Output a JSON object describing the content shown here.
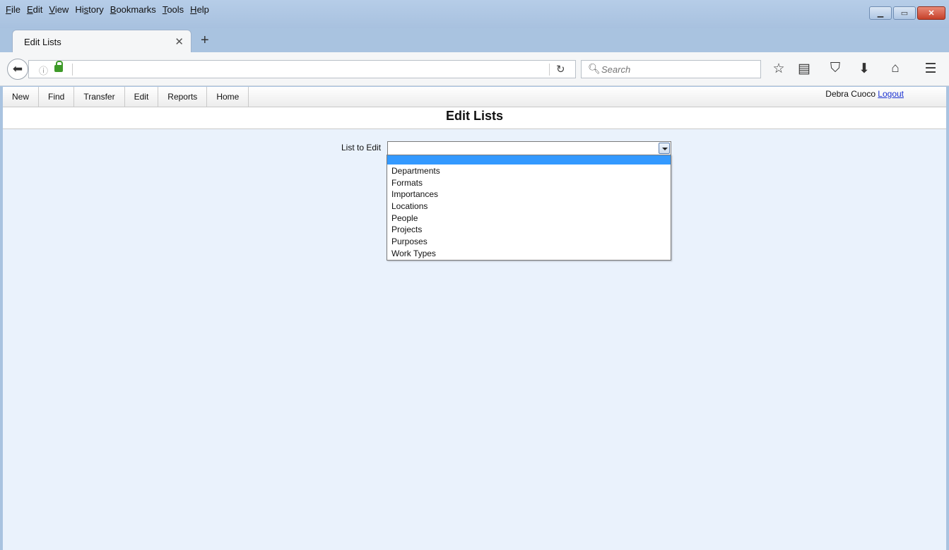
{
  "menu": [
    "File",
    "Edit",
    "View",
    "History",
    "Bookmarks",
    "Tools",
    "Help"
  ],
  "menu_mnemonics": [
    "F",
    "E",
    "V",
    "s",
    "B",
    "T",
    "H"
  ],
  "window_controls": [
    "minimize-icon",
    "maximize-icon",
    "close-icon"
  ],
  "tab": {
    "title": "Edit Lists",
    "close_glyph": "✕"
  },
  "new_tab_glyph": "+",
  "navbar": {
    "back_icon": "back-arrow-icon",
    "url": "",
    "search_placeholder": "Search",
    "toolbar_icons": [
      "bookmark-star-icon",
      "reading-list-icon",
      "pocket-icon",
      "download-icon",
      "home-icon",
      "hamburger-menu-icon"
    ]
  },
  "app_nav": {
    "items": [
      "New",
      "Find",
      "Transfer",
      "Edit",
      "Reports",
      "Home"
    ],
    "user": "Debra Cuoco",
    "logout": "Logout"
  },
  "page": {
    "title": "Edit Lists",
    "field_label": "List to Edit",
    "selected_value": "",
    "options": [
      "",
      "Departments",
      "Formats",
      "Importances",
      "Locations",
      "People",
      "Projects",
      "Purposes",
      "Work Types"
    ]
  },
  "colors": {
    "chrome": "#a9c3e0",
    "content_bg": "#eaf2fc",
    "selection": "#3399ff",
    "link": "#1d33d1"
  }
}
